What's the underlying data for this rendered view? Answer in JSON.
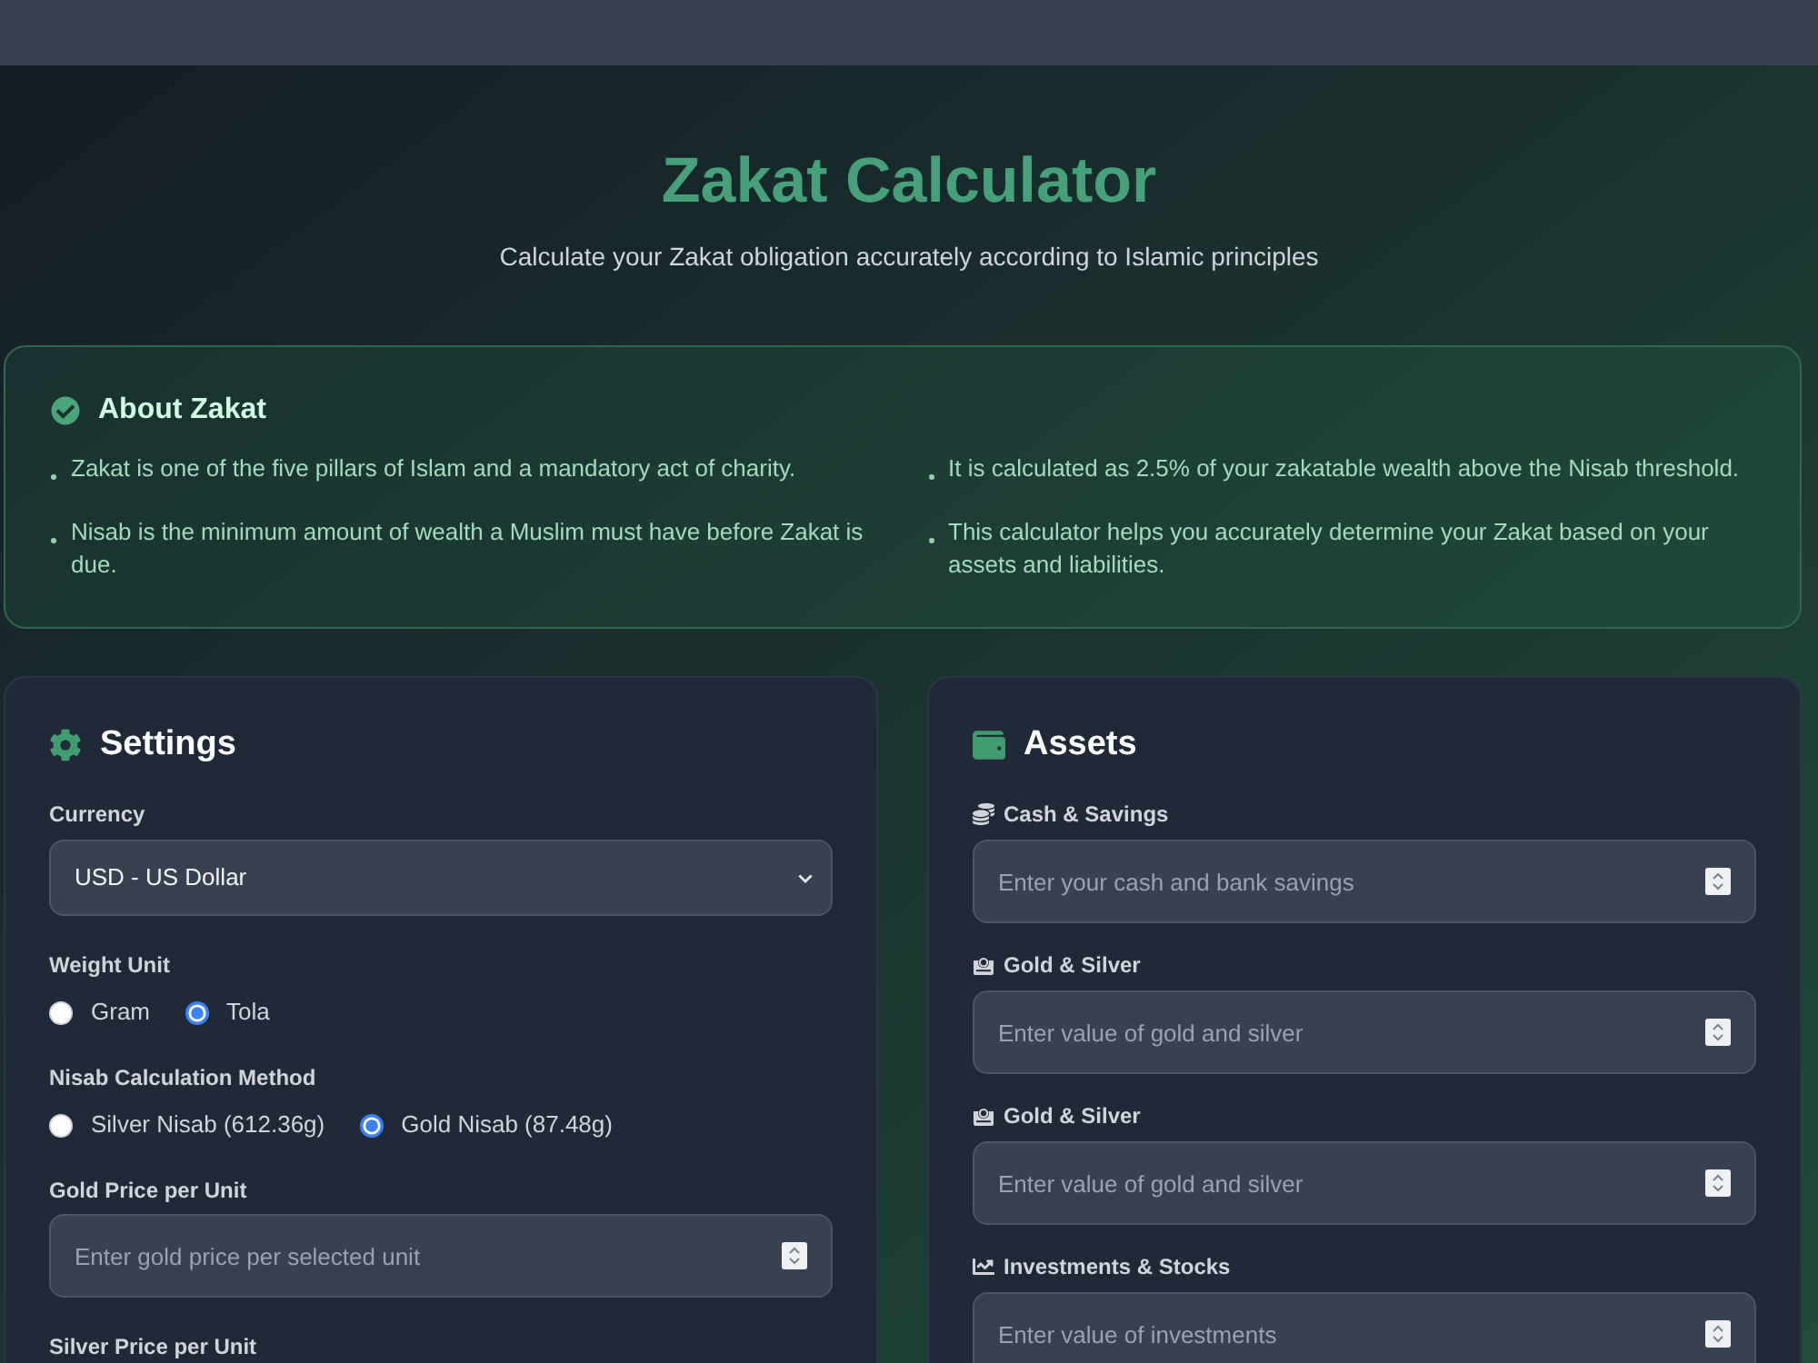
{
  "header": {
    "title": "Zakat Calculator",
    "subtitle": "Calculate your Zakat obligation accurately according to Islamic principles"
  },
  "about": {
    "title": "About Zakat",
    "points": [
      "Zakat is one of the five pillars of Islam and a mandatory act of charity.",
      "It is calculated as 2.5% of your zakatable wealth above the Nisab threshold.",
      "Nisab is the minimum amount of wealth a Muslim must have before Zakat is due.",
      "This calculator helps you accurately determine your Zakat based on your assets and liabilities."
    ]
  },
  "settings": {
    "title": "Settings",
    "currency": {
      "label": "Currency",
      "value": "USD - US Dollar"
    },
    "weight_unit": {
      "label": "Weight Unit",
      "options": [
        {
          "label": "Gram",
          "selected": false
        },
        {
          "label": "Tola",
          "selected": true
        }
      ]
    },
    "nisab_method": {
      "label": "Nisab Calculation Method",
      "options": [
        {
          "label": "Silver Nisab (612.36g)",
          "selected": false
        },
        {
          "label": "Gold Nisab (87.48g)",
          "selected": true
        }
      ]
    },
    "gold_price": {
      "label": "Gold Price per Unit",
      "placeholder": "Enter gold price per selected unit"
    },
    "silver_price": {
      "label": "Silver Price per Unit"
    }
  },
  "assets": {
    "title": "Assets",
    "fields": [
      {
        "kind": "cash",
        "label": "Cash & Savings",
        "placeholder": "Enter your cash and bank savings"
      },
      {
        "kind": "precious_metals",
        "label": "Gold & Silver",
        "placeholder": "Enter value of gold and silver"
      },
      {
        "kind": "precious_metals",
        "label": "Gold & Silver",
        "placeholder": "Enter value of gold and silver"
      },
      {
        "kind": "investments",
        "label": "Investments & Stocks",
        "placeholder": "Enter value of investments"
      }
    ]
  }
}
